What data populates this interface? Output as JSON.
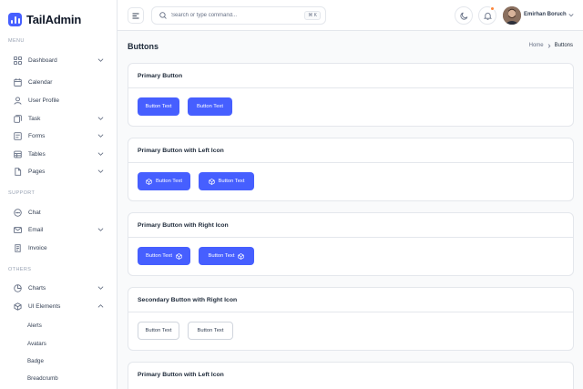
{
  "brand": {
    "name": "TailAdmin"
  },
  "sidebar": {
    "menu_title": "MENU",
    "support_title": "SUPPORT",
    "others_title": "OTHERS",
    "menu": [
      {
        "label": "Dashboard",
        "icon": "grid-icon"
      },
      {
        "label": "Calendar",
        "icon": "calendar-icon"
      },
      {
        "label": "User Profile",
        "icon": "user-icon"
      },
      {
        "label": "Task",
        "icon": "task-icon"
      },
      {
        "label": "Forms",
        "icon": "forms-icon"
      },
      {
        "label": "Tables",
        "icon": "table-icon"
      },
      {
        "label": "Pages",
        "icon": "pages-icon"
      }
    ],
    "support": [
      {
        "label": "Chat",
        "icon": "chat-icon"
      },
      {
        "label": "Email",
        "icon": "mail-icon"
      },
      {
        "label": "Invoice",
        "icon": "invoice-icon"
      }
    ],
    "others": [
      {
        "label": "Charts",
        "icon": "pie-chart-icon"
      },
      {
        "label": "UI Elements",
        "icon": "box-icon"
      }
    ],
    "ui_sub": [
      "Alerts",
      "Avatars",
      "Badge",
      "Breadcrumb"
    ]
  },
  "header": {
    "search_placeholder": "Search or type command...",
    "search_shortcut": "⌘ K",
    "user_name": "Emirhan Boruch"
  },
  "page": {
    "title": "Buttons",
    "breadcrumb_home": "Home",
    "breadcrumb_current": "Buttons"
  },
  "cards": [
    {
      "title": "Primary Button",
      "buttons": [
        "Button Text",
        "Button Text"
      ]
    },
    {
      "title": "Primary Button with Left Icon",
      "buttons": [
        "Button Text",
        "Button Text"
      ]
    },
    {
      "title": "Primary Button with Right Icon",
      "buttons": [
        "Button Text",
        "Button Text"
      ]
    },
    {
      "title": "Secondary Button with Right Icon",
      "buttons": [
        "Button Text",
        "Button Text"
      ]
    },
    {
      "title": "Primary Button with Left Icon"
    }
  ],
  "colors": {
    "primary": "#465fff",
    "notification": "#fd853a"
  }
}
